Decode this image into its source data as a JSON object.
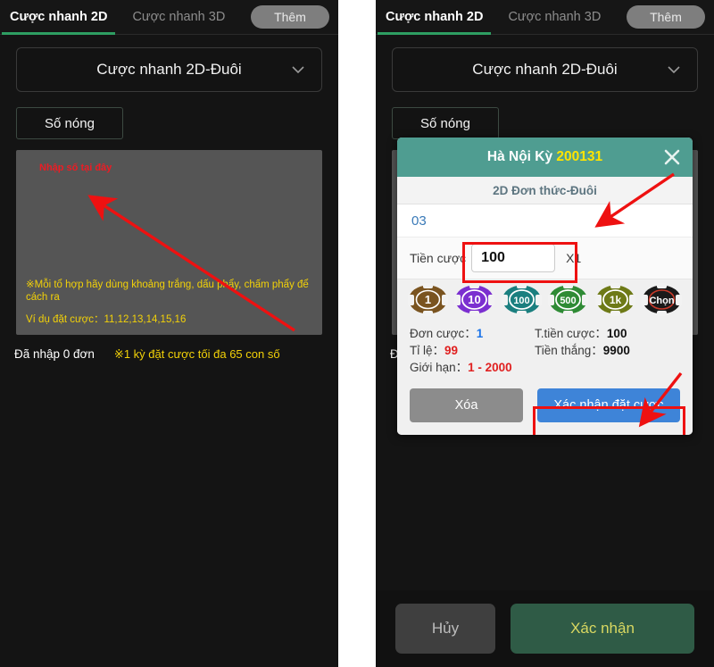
{
  "tabs": {
    "tab_2d": "Cược nhanh 2D",
    "tab_3d": "Cược nhanh 3D",
    "more": "Thêm"
  },
  "select": {
    "value": "Cược nhanh 2D-Đuôi",
    "chevron_icon": "chevron-down-icon"
  },
  "hot_button": "Số nóng",
  "textarea": {
    "placeholder": "Nhập số tại đây",
    "note_1": "※Mỗi tổ hợp hãy dùng khoảng trắng, dấu phẩy, chấm phẩy để cách ra",
    "note_2": "Ví dụ đặt cược：11,12,13,14,15,16"
  },
  "footer": {
    "entered": "Đã nhập 0 đơn",
    "limit": "※1 kỳ đặt cược tối đa 65 con số"
  },
  "action_bar": {
    "cancel": "Hủy",
    "confirm": "Xác nhận"
  },
  "modal": {
    "title_prefix": "Hà Nội Kỳ ",
    "title_number": "200131",
    "close_icon": "close-icon",
    "subtitle": "2D Đơn thức-Đuôi",
    "selected_number": "03",
    "stake_label": "Tiền cược",
    "stake_value": "100",
    "multiplier": "X1",
    "chips": [
      {
        "label": "1",
        "color": "#7a5420"
      },
      {
        "label": "10",
        "color": "#7b2fd0"
      },
      {
        "label": "100",
        "color": "#1b7f7f"
      },
      {
        "label": "500",
        "color": "#2f8b35"
      },
      {
        "label": "1k",
        "color": "#6e7a17"
      },
      {
        "label": "Chọn",
        "color": "#1a1a1a"
      }
    ],
    "stats": {
      "orders_label": "Đơn cược：",
      "orders_value": "1",
      "rate_label": "Tỉ lệ：",
      "rate_value": "99",
      "limit_label": "Giới hạn：",
      "limit_value": "1 - 2000",
      "total_label": "T.tiền cược：",
      "total_value": "100",
      "win_label": "Tiền thắng：",
      "win_value": "9900"
    },
    "delete_button": "Xóa",
    "confirm_button": "Xác nhận đặt cược"
  },
  "colors": {
    "accent_green": "#2e9e62",
    "modal_teal": "#4f9d91",
    "highlight_red": "#ee1111",
    "note_yellow": "#f2d108",
    "placeholder_red": "#ec1c24",
    "primary_blue": "#3e84d8"
  }
}
